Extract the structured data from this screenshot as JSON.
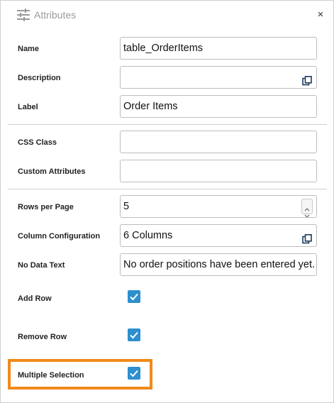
{
  "header": {
    "title": "Attributes",
    "settings_icon": "sliders-icon",
    "close_label": "×"
  },
  "fields": {
    "name": {
      "label": "Name",
      "value": "table_OrderItems"
    },
    "description": {
      "label": "Description",
      "value": "",
      "button_icon": "copy-icon"
    },
    "label": {
      "label": "Label",
      "value": "Order Items"
    },
    "css_class": {
      "label": "CSS Class",
      "value": ""
    },
    "custom_attributes": {
      "label": "Custom Attributes",
      "value": ""
    },
    "rows_per_page": {
      "label": "Rows per Page",
      "value": "5"
    },
    "column_configuration": {
      "label": "Column Configuration",
      "value": "6 Columns",
      "button_icon": "copy-icon"
    },
    "no_data_text": {
      "label": "No Data Text",
      "value": "No order positions have been entered yet."
    }
  },
  "checkboxes": {
    "add_row": {
      "label": "Add Row",
      "checked": true
    },
    "remove_row": {
      "label": "Remove Row",
      "checked": true
    },
    "multiple_selection": {
      "label": "Multiple Selection",
      "checked": true
    }
  },
  "colors": {
    "checkbox": "#2d8fce",
    "highlight": "#f08a1c"
  }
}
